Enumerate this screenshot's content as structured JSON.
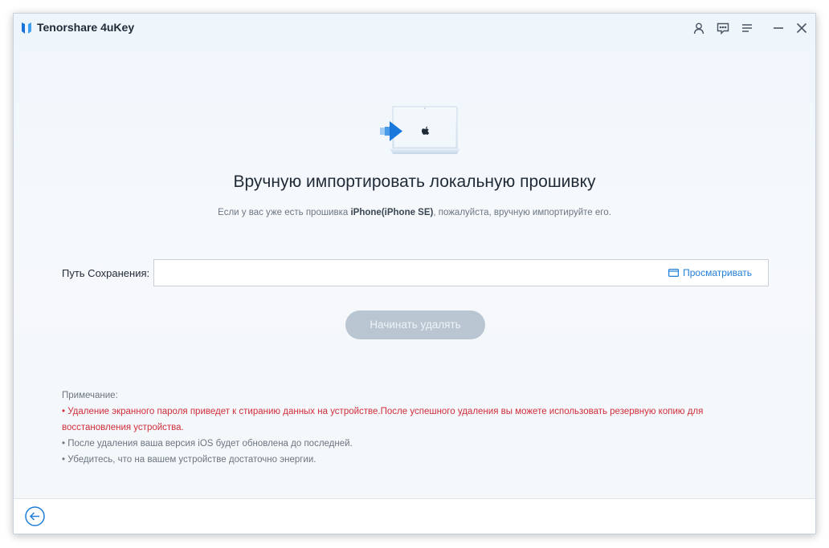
{
  "app": {
    "title": "Tenorshare 4uKey"
  },
  "titlebar": {
    "icons": [
      "user-icon",
      "feedback-icon",
      "menu-icon",
      "minimize-icon",
      "close-icon"
    ]
  },
  "main": {
    "heading": "Вручную импортировать локальную прошивку",
    "subtitle_prefix": "Если у вас уже есть прошивка ",
    "subtitle_device": "iPhone(iPhone SE)",
    "subtitle_suffix": ", пожалуйста, вручную импортируйте его."
  },
  "path": {
    "label": "Путь Сохранения:",
    "value": "",
    "placeholder": "",
    "browse_label": "Просматривать"
  },
  "start_button": {
    "label": "Начинать удалять",
    "enabled": false
  },
  "note": {
    "title": "Примечание:",
    "items": [
      "• Удаление экранного пароля приведет к стиранию данных на устройстве.После успешного удаления вы можете использовать резервную копию для восстановления устройства.",
      "• После удаления ваша версия iOS будет обновлена до последней.",
      "• Убедитесь, что на вашем устройстве достаточно энергии."
    ]
  },
  "colors": {
    "accent": "#1f7ed8",
    "warning": "#d02d3a",
    "button_disabled": "#b9c6d2"
  }
}
